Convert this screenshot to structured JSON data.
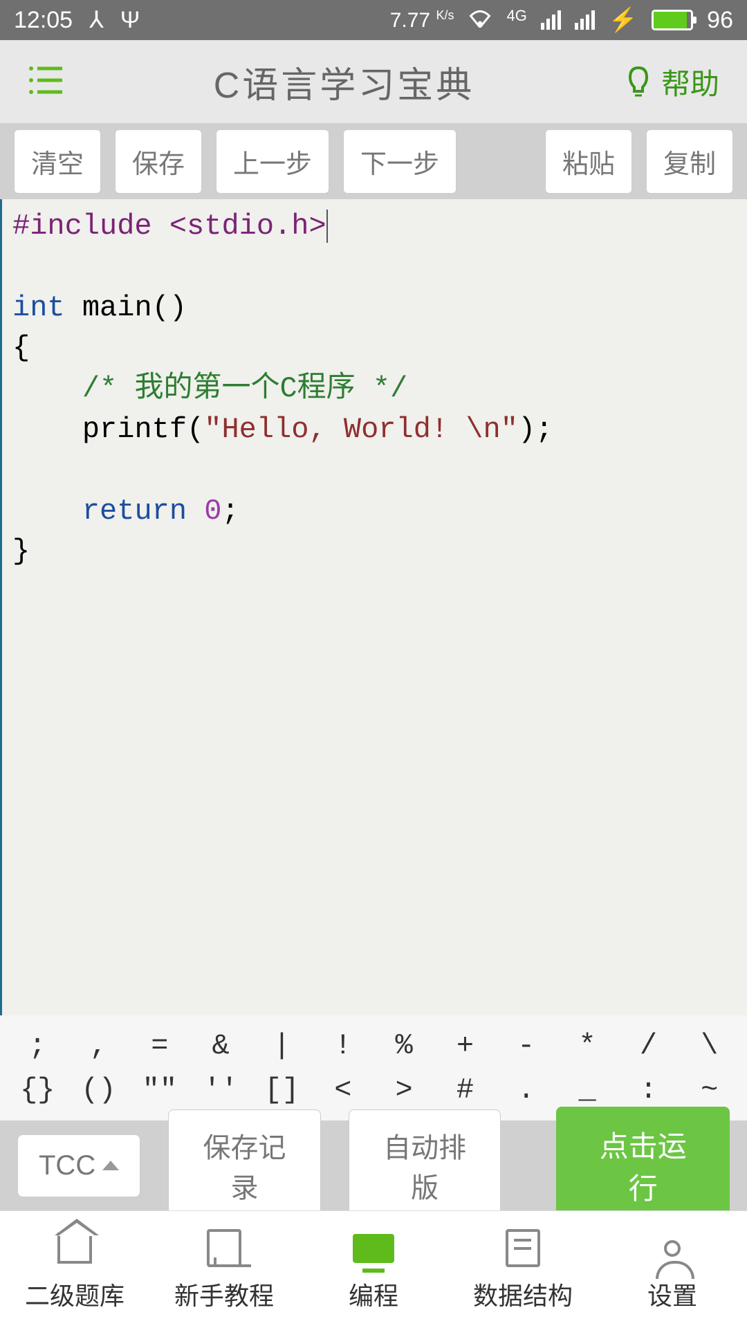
{
  "status": {
    "time": "12:05",
    "speed_value": "7.77",
    "speed_unit": "K/s",
    "network_label": "4G",
    "battery": "96"
  },
  "header": {
    "title": "C语言学习宝典",
    "help": "帮助"
  },
  "toolbar": {
    "clear": "清空",
    "save": "保存",
    "prev": "上一步",
    "next": "下一步",
    "paste": "粘贴",
    "copy": "复制"
  },
  "code": {
    "include_kw": "#include",
    "include_hdr": " <stdio.h>",
    "type_int": "int",
    "main_sig": " main()",
    "brace_open": "{",
    "comment": "/* 我的第一个C程序 */",
    "printf_call": "printf(",
    "string_lit": "\"Hello, World! \\n\"",
    "printf_end": ");",
    "return_kw": "return",
    "return_val": " 0",
    "return_end": ";",
    "brace_close": "}"
  },
  "symbols_row1": [
    ";",
    ",",
    "=",
    "&",
    "|",
    "!",
    "%",
    "+",
    "-",
    "*",
    "/",
    "\\"
  ],
  "symbols_row2": [
    "{}",
    "()",
    "\"\"",
    "''",
    "[]",
    "<",
    ">",
    "#",
    ".",
    "_",
    ":",
    "~"
  ],
  "actions": {
    "compiler": "TCC",
    "save_history": "保存记录",
    "auto_format": "自动排版",
    "run": "点击运行"
  },
  "nav": {
    "exam": "二级题库",
    "tutorial": "新手教程",
    "code": "编程",
    "ds": "数据结构",
    "settings": "设置"
  }
}
